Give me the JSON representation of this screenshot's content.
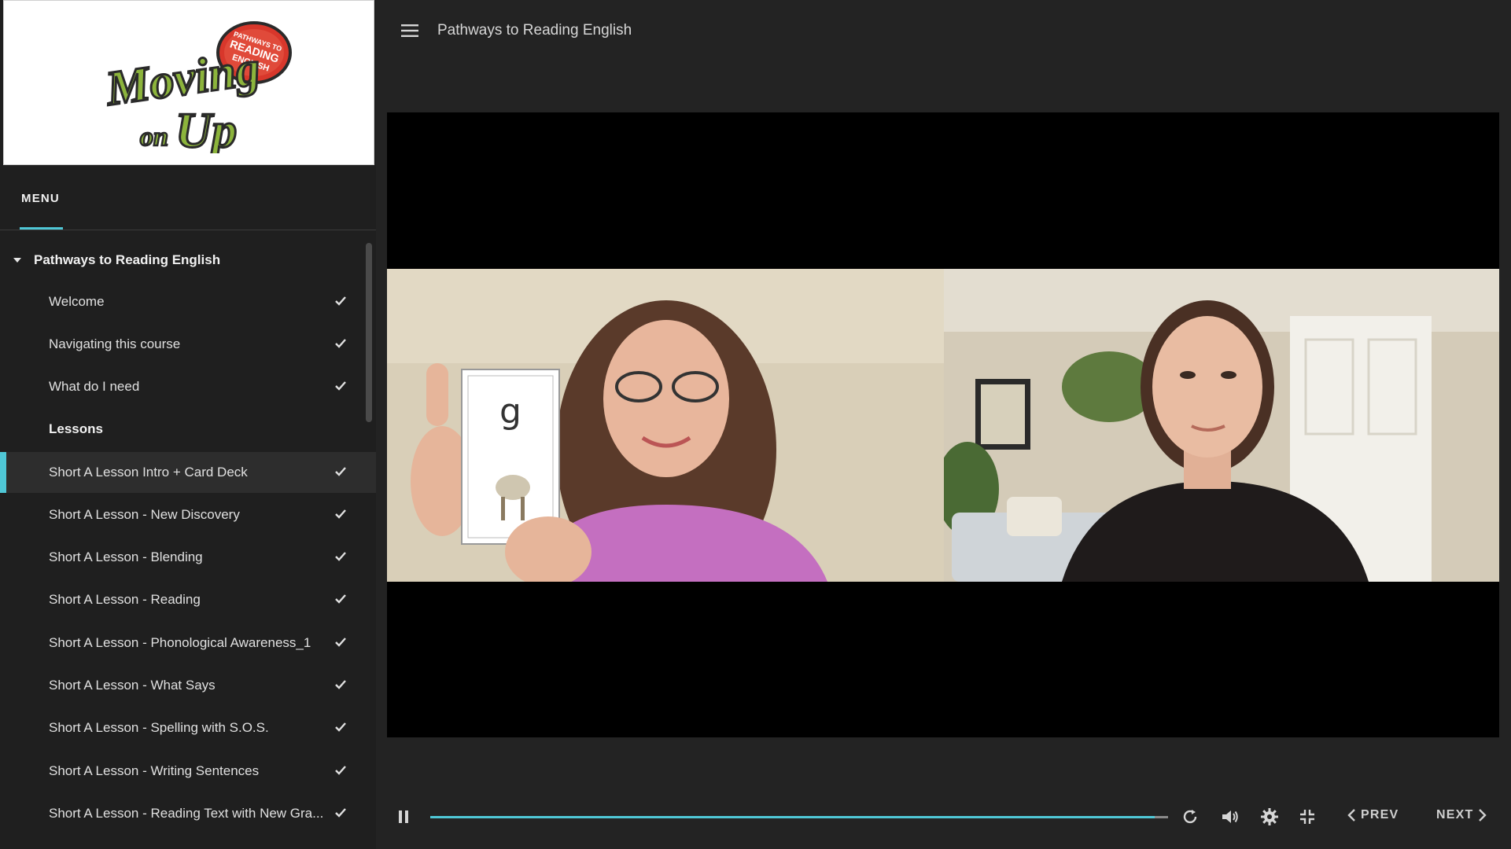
{
  "logo": {
    "text_main": "Moving on Up",
    "text_bubble": "PATHWAYS TO READING ENGLISH",
    "colors": {
      "green": "#8cb43c",
      "red": "#d8372b"
    }
  },
  "sidebar": {
    "tab_label": "MENU",
    "section_title": "Pathways to Reading English",
    "items": [
      {
        "label": "Welcome",
        "done": true
      },
      {
        "label": "Navigating this course",
        "done": true
      },
      {
        "label": "What do I need",
        "done": true
      },
      {
        "label": "Lessons",
        "heading": true
      },
      {
        "label": "Short A Lesson Intro + Card Deck",
        "done": true,
        "active": true
      },
      {
        "label": "Short A Lesson - New Discovery",
        "done": true
      },
      {
        "label": "Short A Lesson - Blending",
        "done": true
      },
      {
        "label": "Short A Lesson - Reading",
        "done": true
      },
      {
        "label": "Short A Lesson - Phonological Awareness_1",
        "done": true
      },
      {
        "label": "Short A Lesson - What Says",
        "done": true
      },
      {
        "label": "Short A Lesson - Spelling with S.O.S.",
        "done": true
      },
      {
        "label": "Short A Lesson - Writing Sentences",
        "done": true
      },
      {
        "label": "Short A Lesson - Reading Text with New Gra...",
        "done": true
      }
    ]
  },
  "header": {
    "title": "Pathways to Reading English",
    "menu_icon": "hamburger-icon"
  },
  "video": {
    "card_letter": "g"
  },
  "controls": {
    "progress": 0.982,
    "prev_label": "PREV",
    "next_label": "NEXT",
    "icons": [
      "pause-icon",
      "replay-icon",
      "volume-icon",
      "settings-icon",
      "exit-fullscreen-icon"
    ]
  },
  "colors": {
    "accent": "#4fc7d6",
    "background": "#232323"
  }
}
